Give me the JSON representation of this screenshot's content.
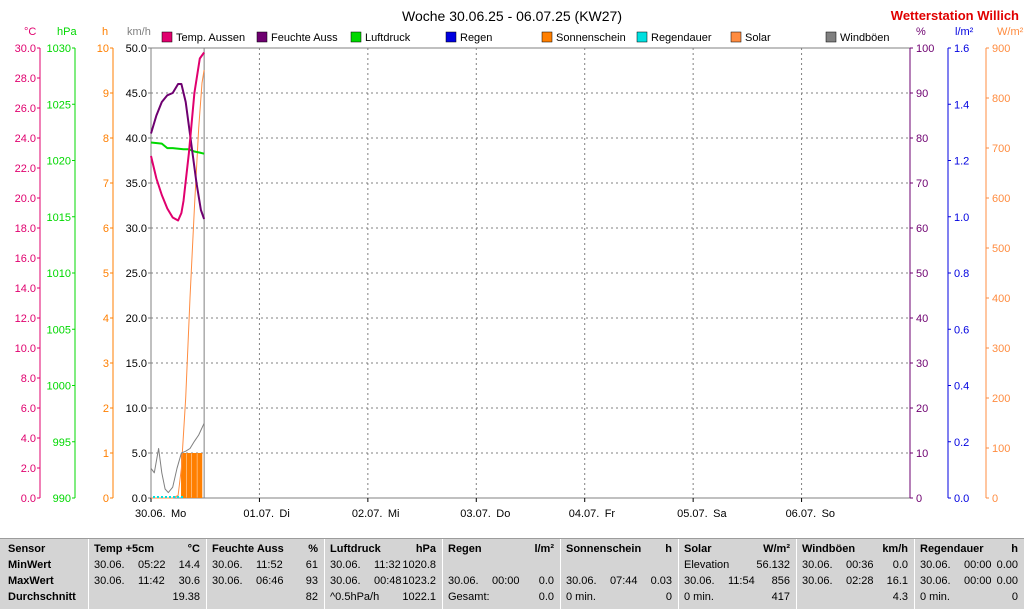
{
  "header": {
    "title": "Woche 30.06.25 - 06.07.25 (KW27)",
    "brand": "Wetterstation Willich"
  },
  "colors": {
    "temp": "#e0006e",
    "humidity": "#6e0070",
    "pressure": "#00d800",
    "rain": "#0000e0",
    "sunshine": "#ff7f00",
    "raindur": "#00e0e0",
    "solar": "#ff8c40",
    "gust": "#808080",
    "brand": "#e00000"
  },
  "chart_data": {
    "type": "line",
    "title": "Woche 30.06.25 - 06.07.25 (KW27)",
    "xlim": [
      0,
      7
    ],
    "x_ticks": [
      "30.06.",
      "01.07.",
      "02.07.",
      "03.07.",
      "04.07.",
      "05.07.",
      "06.07."
    ],
    "x_day_names": [
      "Mo",
      "Di",
      "Mi",
      "Do",
      "Fr",
      "Sa",
      "So"
    ],
    "axes": [
      {
        "id": "temp",
        "unit": "°C",
        "range": [
          0,
          30
        ],
        "ticks": [
          "0.0",
          "2.0",
          "4.0",
          "6.0",
          "8.0",
          "10.0",
          "12.0",
          "14.0",
          "16.0",
          "18.0",
          "20.0",
          "22.0",
          "24.0",
          "26.0",
          "28.0",
          "30.0"
        ]
      },
      {
        "id": "pressure",
        "unit": "hPa",
        "range": [
          990,
          1030
        ],
        "ticks": [
          "990",
          "995",
          "1000",
          "1005",
          "1010",
          "1015",
          "1020",
          "1025",
          "1030"
        ]
      },
      {
        "id": "sunshine",
        "unit": "h",
        "range": [
          0,
          10
        ],
        "ticks": [
          "0",
          "1",
          "2",
          "3",
          "4",
          "5",
          "6",
          "7",
          "8",
          "9",
          "10"
        ]
      },
      {
        "id": "wind",
        "unit": "km/h",
        "range": [
          0,
          50
        ],
        "ticks": [
          "0.0",
          "5.0",
          "10.0",
          "15.0",
          "20.0",
          "25.0",
          "30.0",
          "35.0",
          "40.0",
          "45.0",
          "50.0"
        ]
      },
      {
        "id": "humidity",
        "unit": "%",
        "range": [
          0,
          100
        ],
        "ticks": [
          "0",
          "10",
          "20",
          "30",
          "40",
          "50",
          "60",
          "70",
          "80",
          "90",
          "100"
        ]
      },
      {
        "id": "rain",
        "unit": "l/m²",
        "range": [
          0,
          1.6
        ],
        "ticks": [
          "0.0",
          "0.2",
          "0.4",
          "0.6",
          "0.8",
          "1.0",
          "1.2",
          "1.4",
          "1.6"
        ]
      },
      {
        "id": "solar",
        "unit": "W/m²",
        "range": [
          0,
          900
        ],
        "ticks": [
          "0",
          "100",
          "200",
          "300",
          "400",
          "500",
          "600",
          "700",
          "800",
          "900"
        ]
      }
    ],
    "series": [
      {
        "name": "Temp. Aussen",
        "axis": "temp",
        "x": [
          0,
          0.05,
          0.1,
          0.15,
          0.2,
          0.25,
          0.28,
          0.3,
          0.35,
          0.4,
          0.45,
          0.49
        ],
        "y": [
          22.8,
          21.3,
          20.2,
          19.3,
          18.7,
          18.5,
          19.0,
          19.8,
          23.0,
          27.0,
          29.3,
          29.7
        ]
      },
      {
        "name": "Feuchte Auss",
        "axis": "humidity",
        "x": [
          0,
          0.05,
          0.1,
          0.15,
          0.2,
          0.25,
          0.28,
          0.32,
          0.37,
          0.42,
          0.46,
          0.49
        ],
        "y": [
          81,
          85,
          88,
          89.5,
          90,
          92,
          92,
          88,
          79,
          70,
          64,
          62
        ]
      },
      {
        "name": "Luftdruck",
        "axis": "pressure",
        "x": [
          0,
          0.1,
          0.15,
          0.2,
          0.3,
          0.35,
          0.4,
          0.45,
          0.49
        ],
        "y": [
          1021.6,
          1021.5,
          1021.1,
          1021.1,
          1021.0,
          1021.0,
          1020.8,
          1020.7,
          1020.6
        ]
      },
      {
        "name": "Regen",
        "axis": "rain",
        "x": [],
        "y": []
      },
      {
        "name": "Sonnenschein",
        "axis": "sunshine",
        "x": [
          0.3,
          0.35,
          0.4,
          0.45
        ],
        "y": [
          1,
          1,
          1,
          1
        ]
      },
      {
        "name": "Regendauer",
        "axis": "rain",
        "x": [],
        "y": []
      },
      {
        "name": "Solar",
        "axis": "solar",
        "x": [
          0,
          0.2,
          0.25,
          0.28,
          0.32,
          0.36,
          0.4,
          0.44,
          0.47,
          0.49
        ],
        "y": [
          0,
          0,
          5,
          60,
          200,
          400,
          580,
          740,
          830,
          856
        ]
      },
      {
        "name": "Windböen",
        "axis": "wind",
        "x": [
          0,
          0.03,
          0.07,
          0.1,
          0.13,
          0.16,
          0.2,
          0.24,
          0.28,
          0.32,
          0.36,
          0.4,
          0.44,
          0.49
        ],
        "y": [
          3.3,
          2.8,
          5.5,
          2.8,
          1.0,
          0.6,
          1.2,
          3.3,
          5.0,
          5.2,
          5.5,
          6.3,
          7.0,
          8.3
        ]
      }
    ],
    "legend": [
      "Temp. Aussen",
      "Feuchte Auss",
      "Luftdruck",
      "Regen",
      "Sonnenschein",
      "Regendauer",
      "Solar",
      "Windböen"
    ],
    "grid": true,
    "legend_position": "top"
  },
  "table": {
    "columns": [
      {
        "header": "Sensor",
        "unit": "",
        "rows": [
          [
            "MinWert",
            "",
            ""
          ],
          [
            "MaxWert",
            "",
            ""
          ],
          [
            "Durchschnitt",
            "",
            ""
          ]
        ]
      },
      {
        "header": "Temp +5cm",
        "unit": "°C",
        "rows": [
          [
            "30.06.",
            "05:22",
            "14.4"
          ],
          [
            "30.06.",
            "11:42",
            "30.6"
          ],
          [
            "",
            "",
            "19.38"
          ]
        ]
      },
      {
        "header": "Feuchte Auss",
        "unit": "%",
        "rows": [
          [
            "30.06.",
            "11:52",
            "61"
          ],
          [
            "30.06.",
            "06:46",
            "93"
          ],
          [
            "",
            "",
            "82"
          ]
        ]
      },
      {
        "header": "Luftdruck",
        "unit": "hPa",
        "rows": [
          [
            "30.06.",
            "11:32",
            "1020.8"
          ],
          [
            "30.06.",
            "00:48",
            "1023.2"
          ],
          [
            "^0.5hPa/h",
            "",
            "1022.1"
          ]
        ]
      },
      {
        "header": "Regen",
        "unit": "l/m²",
        "rows": [
          [
            "",
            "",
            ""
          ],
          [
            "30.06.",
            "00:00",
            "0.0"
          ],
          [
            "Gesamt:",
            "",
            "0.0"
          ]
        ]
      },
      {
        "header": "Sonnenschein",
        "unit": "h",
        "rows": [
          [
            "",
            "",
            ""
          ],
          [
            "30.06.",
            "07:44",
            "0.03"
          ],
          [
            "0 min.",
            "",
            "0"
          ]
        ]
      },
      {
        "header": "Solar",
        "unit": "W/m²",
        "rows": [
          [
            "Elevation",
            "",
            "56.132"
          ],
          [
            "30.06.",
            "11:54",
            "856"
          ],
          [
            "0 min.",
            "",
            "417"
          ]
        ]
      },
      {
        "header": "Windböen",
        "unit": "km/h",
        "rows": [
          [
            "30.06.",
            "00:36",
            "0.0"
          ],
          [
            "30.06.",
            "02:28",
            "16.1"
          ],
          [
            "",
            "",
            "4.3"
          ]
        ]
      },
      {
        "header": "Regendauer",
        "unit": "h",
        "rows": [
          [
            "30.06.",
            "00:00",
            "0.00"
          ],
          [
            "30.06.",
            "00:00",
            "0.00"
          ],
          [
            "0 min.",
            "",
            "0"
          ]
        ]
      }
    ]
  }
}
